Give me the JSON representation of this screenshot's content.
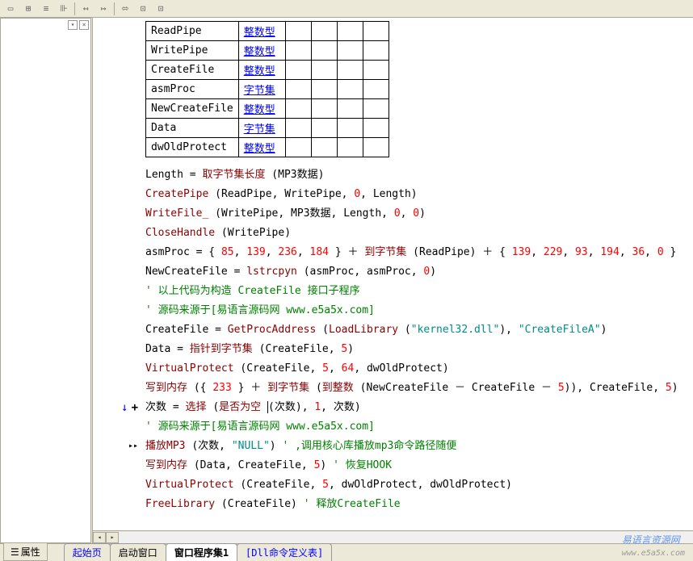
{
  "toolbar_icons": [
    "tb1",
    "tb2",
    "tb3",
    "tb4",
    "tb5",
    "tb6",
    "tb7",
    "tb8",
    "tb9"
  ],
  "vars": [
    {
      "name": "ReadPipe",
      "type": "整数型"
    },
    {
      "name": "WritePipe",
      "type": "整数型"
    },
    {
      "name": "CreateFile",
      "type": "整数型"
    },
    {
      "name": "asmProc",
      "type": "字节集"
    },
    {
      "name": "NewCreateFile",
      "type": "整数型"
    },
    {
      "name": "Data",
      "type": "字节集"
    },
    {
      "name": "dwOldProtect",
      "type": "整数型"
    }
  ],
  "code": {
    "l1": {
      "a": "Length",
      "b": "=",
      "c": "取字节集长度",
      "d": "MP3数据"
    },
    "l2": {
      "a": "CreatePipe",
      "p1": "ReadPipe",
      "p2": "WritePipe",
      "p3": "0",
      "p4": "Length"
    },
    "l3": {
      "a": "WriteFile_",
      "p1": "WritePipe",
      "p2": "MP3数据",
      "p3": "Length",
      "p4": "0",
      "p5": "0"
    },
    "l4": {
      "a": "CloseHandle",
      "p1": "WritePipe"
    },
    "l5": {
      "a": "asmProc",
      "b": "=",
      "n1": "85",
      "n2": "139",
      "n3": "236",
      "n4": "184",
      "c": "到字节集",
      "p1": "ReadPipe",
      "n5": "139",
      "n6": "229",
      "n7": "93",
      "n8": "194",
      "n9": "36",
      "n10": "0"
    },
    "l6": {
      "a": "NewCreateFile",
      "b": "=",
      "c": "lstrcpyn",
      "p1": "asmProc",
      "p2": "asmProc",
      "p3": "0"
    },
    "l7": {
      "c": "' 以上代码为构造 CreateFile 接口子程序"
    },
    "l8": {
      "c": "' 源码来源于[易语言源码网 www.e5a5x.com]"
    },
    "l9": {
      "a": "CreateFile",
      "b": "=",
      "c": "GetProcAddress",
      "d": "LoadLibrary",
      "s1": "\"kernel32.dll\"",
      "s2": "\"CreateFileA\""
    },
    "l10": {
      "a": "Data",
      "b": "=",
      "c": "指针到字节集",
      "p1": "CreateFile",
      "p2": "5"
    },
    "l11": {
      "a": "VirtualProtect",
      "p1": "CreateFile",
      "p2": "5",
      "p3": "64",
      "p4": "dwOldProtect"
    },
    "l12": {
      "a": "写到内存",
      "n1": "233",
      "c": "到字节集",
      "d": "到整数",
      "p1": "NewCreateFile",
      "p2": "CreateFile",
      "p3": "5",
      "p4": "CreateFile",
      "p5": "5"
    },
    "l13": {
      "a": "次数",
      "b": "=",
      "c": "选择",
      "d": "是否为空",
      "p1": "次数",
      "p2": "1",
      "p3": "次数"
    },
    "l14": {
      "c": "' 源码来源于[易语言源码网 www.e5a5x.com]"
    },
    "l15": {
      "a": "播放MP3",
      "p1": "次数",
      "s1": "\"NULL\"",
      "c": "'  ,调用核心库播放mp3命令路径随便"
    },
    "l16": {
      "a": "写到内存",
      "p1": "Data",
      "p2": "CreateFile",
      "p3": "5",
      "c": "' 恢复HOOK"
    },
    "l17": {
      "a": "VirtualProtect",
      "p1": "CreateFile",
      "p2": "5",
      "p3": "dwOldProtect",
      "p4": "dwOldProtect"
    },
    "l18": {
      "a": "FreeLibrary",
      "p1": "CreateFile",
      "c": "' 释放CreateFile"
    }
  },
  "prop_btn": "属性",
  "tabs": {
    "t1": "起始页",
    "t2": "启动窗口",
    "t3": "窗口程序集1",
    "t4": "[Dll命令定义表]"
  },
  "watermark": {
    "main": "易语言资源网",
    "sub": "www.e5a5x.com"
  }
}
